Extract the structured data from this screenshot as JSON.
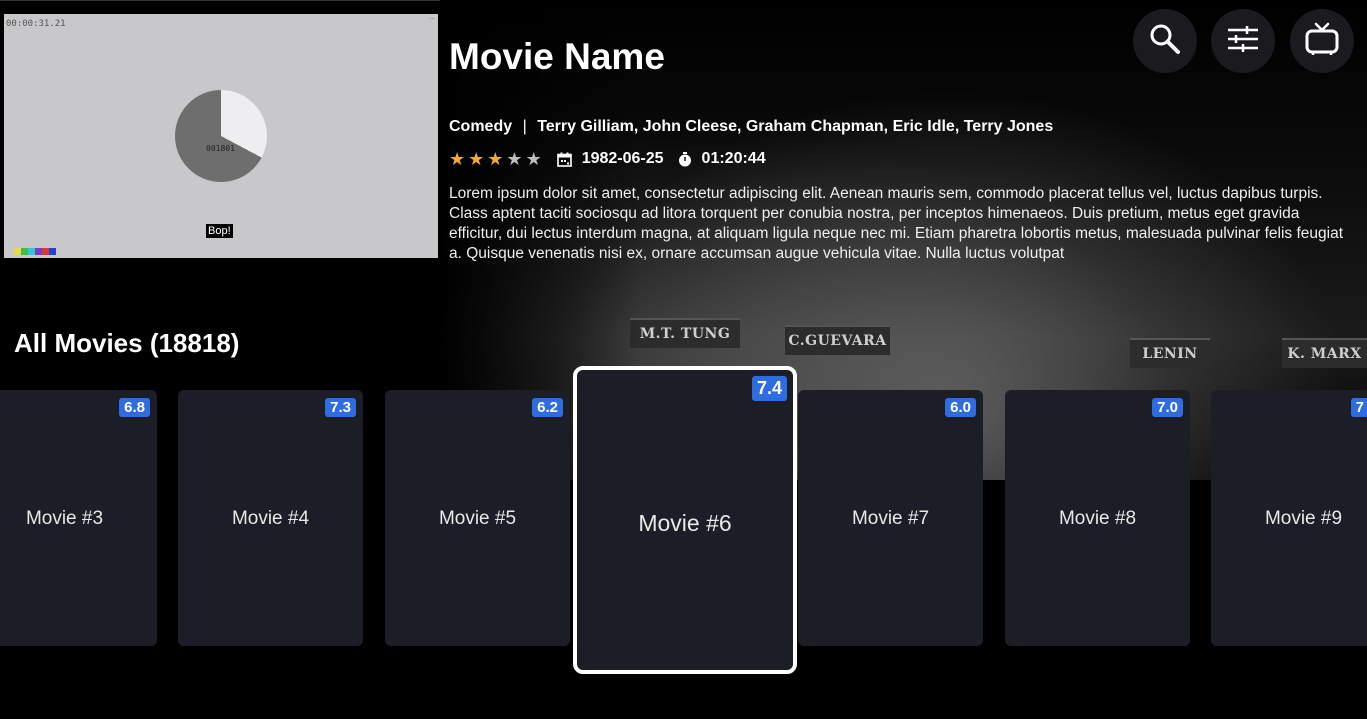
{
  "preview": {
    "timecode": "00:00:31.21",
    "counter": "001801",
    "bop": "Bop!",
    "corner": "...",
    "color_bars": [
      "#e8d84a",
      "#3fbf4a",
      "#36c5d8",
      "#7a3fbf",
      "#d83a3a",
      "#2a3fd0"
    ]
  },
  "hero": {
    "title": "Movie Name",
    "genre": "Comedy",
    "separator": "|",
    "cast": "Terry Gilliam, John Cleese, Graham Chapman, Eric Idle, Terry Jones",
    "rating_stars": 3,
    "rating_max": 5,
    "date": "1982-06-25",
    "duration": "01:20:44",
    "description": "Lorem ipsum dolor sit amet, consectetur adipiscing elit. Aenean mauris sem, commodo placerat tellus vel, luctus dapibus turpis. Class aptent taciti sociosqu ad litora torquent per conubia nostra, per inceptos himenaeos. Duis pretium, metus eget gravida efficitur, dui lectus interdum magna, at aliquam ligula neque nec mi. Etiam pharetra lobortis metus, malesuada pulvinar felis feugiat a. Quisque venenatis nisi ex, ornare accumsan augue vehicula vitae. Nulla luctus volutpat",
    "background_plates": [
      "M.T. TUNG",
      "C.GUEVARA",
      "LENIN",
      "K. MARX"
    ]
  },
  "toolbar": {
    "icons": [
      "search-icon",
      "filter-sliders-icon",
      "tv-icon"
    ]
  },
  "section": {
    "title": "All Movies (18818)"
  },
  "movies": [
    {
      "label": "Movie #3",
      "rating": "6.8"
    },
    {
      "label": "Movie #4",
      "rating": "7.3"
    },
    {
      "label": "Movie #5",
      "rating": "6.2"
    },
    {
      "label": "Movie #6",
      "rating": "7.4",
      "focused": true
    },
    {
      "label": "Movie #7",
      "rating": "6.0"
    },
    {
      "label": "Movie #8",
      "rating": "7.0"
    },
    {
      "label": "Movie #9",
      "rating": "7"
    }
  ],
  "colors": {
    "accent_badge": "#2f6cdf",
    "star_on": "#f0a93a",
    "star_off": "#bdbdbd",
    "card_bg": "#1b1e27"
  }
}
